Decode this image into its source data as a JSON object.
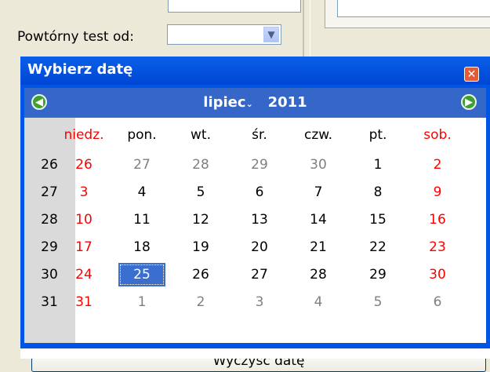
{
  "form": {
    "field_label": "Powtórny test od:",
    "field_value": ""
  },
  "popup": {
    "title": "Wybierz datę",
    "month": "lipiec",
    "year": "2011",
    "weekdays": [
      "niedz.",
      "pon.",
      "wt.",
      "śr.",
      "czw.",
      "pt.",
      "sob."
    ],
    "weeks": [
      {
        "week": "26",
        "days": [
          "26",
          "27",
          "28",
          "29",
          "30",
          "1",
          "2"
        ]
      },
      {
        "week": "27",
        "days": [
          "3",
          "4",
          "5",
          "6",
          "7",
          "8",
          "9"
        ]
      },
      {
        "week": "28",
        "days": [
          "10",
          "11",
          "12",
          "13",
          "14",
          "15",
          "16"
        ]
      },
      {
        "week": "29",
        "days": [
          "17",
          "18",
          "19",
          "20",
          "21",
          "22",
          "23"
        ]
      },
      {
        "week": "30",
        "days": [
          "24",
          "25",
          "26",
          "27",
          "28",
          "29",
          "30"
        ]
      },
      {
        "week": "31",
        "days": [
          "31",
          "1",
          "2",
          "3",
          "4",
          "5",
          "6"
        ]
      }
    ],
    "selected_day": "25",
    "clear_label": "Wyczyść datę"
  },
  "icons": {
    "prev": "arrow-left-icon",
    "next": "arrow-right-icon",
    "close": "close-icon",
    "dropdown": "chevron-down-icon"
  },
  "colors": {
    "title_bar": "#0055e5",
    "header": "#3567c9",
    "weekend": "#ff0000",
    "other_month": "#808080",
    "selected": "#3a6fd0"
  }
}
